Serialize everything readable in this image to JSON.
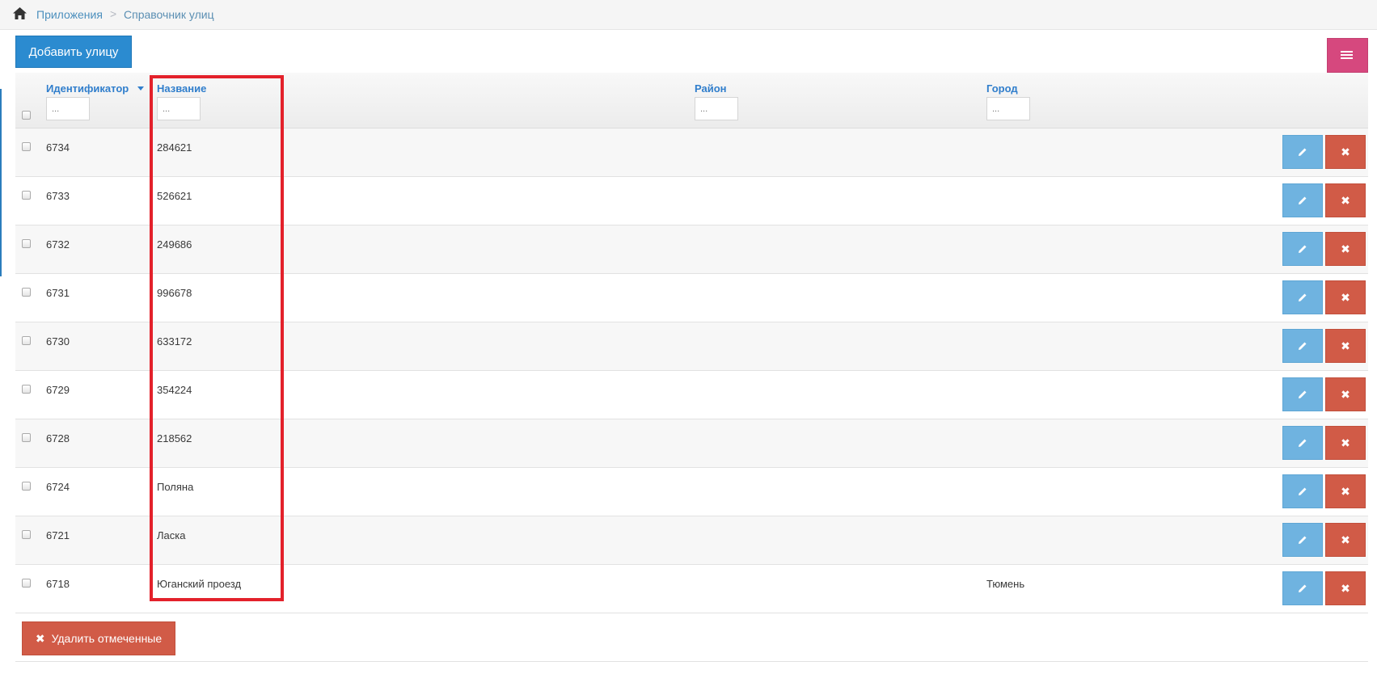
{
  "breadcrumbs": {
    "items": [
      "Приложения",
      "Справочник улиц"
    ],
    "separator": ">"
  },
  "toolbar": {
    "add_label": "Добавить улицу",
    "menu_icon": "list-icon"
  },
  "table": {
    "columns": [
      "Идентификатор",
      "Название",
      "Район",
      "Город"
    ],
    "filter_placeholder": "...",
    "sorted_column": "Идентификатор",
    "rows": [
      {
        "id": "6734",
        "name": "284621",
        "district": "",
        "city": ""
      },
      {
        "id": "6733",
        "name": "526621",
        "district": "",
        "city": ""
      },
      {
        "id": "6732",
        "name": "249686",
        "district": "",
        "city": ""
      },
      {
        "id": "6731",
        "name": "996678",
        "district": "",
        "city": ""
      },
      {
        "id": "6730",
        "name": "633172",
        "district": "",
        "city": ""
      },
      {
        "id": "6729",
        "name": "354224",
        "district": "",
        "city": ""
      },
      {
        "id": "6728",
        "name": "218562",
        "district": "",
        "city": ""
      },
      {
        "id": "6724",
        "name": "Поляна",
        "district": "",
        "city": ""
      },
      {
        "id": "6721",
        "name": "Ласка",
        "district": "",
        "city": ""
      },
      {
        "id": "6718",
        "name": "Юганский проезд",
        "district": "",
        "city": "Тюмень"
      }
    ]
  },
  "footer": {
    "delete_selected_label": "Удалить отмеченные"
  },
  "colors": {
    "primary": "#2b8bd0",
    "pink": "#d6487e",
    "edit": "#6fb3e0",
    "delete": "#d15b47",
    "header_link": "#307ecc",
    "highlight": "#e3212b"
  }
}
